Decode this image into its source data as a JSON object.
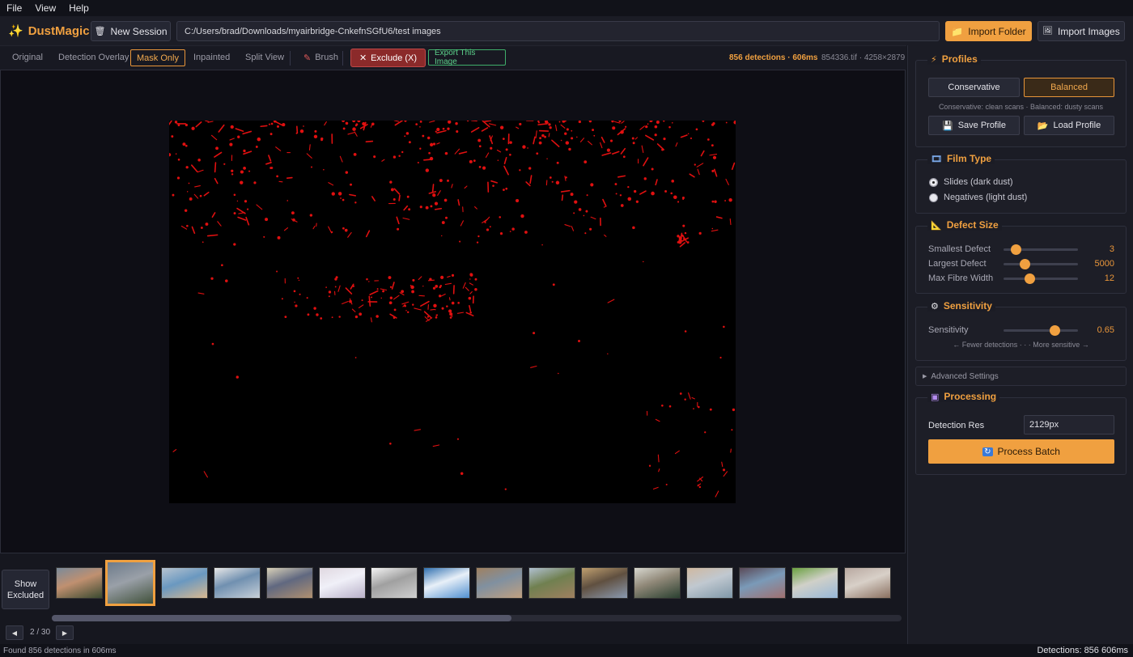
{
  "menu": {
    "file": "File",
    "view": "View",
    "help": "Help"
  },
  "app": {
    "name": "DustMagic"
  },
  "toolbar": {
    "new_session": "New Session",
    "path": "C:/Users/brad/Downloads/myairbridge-CnkefnSGfU6/test images",
    "import_folder": "Import Folder",
    "import_images": "Import Images"
  },
  "viewbar": {
    "tabs": [
      "Original",
      "Detection Overlay",
      "Mask Only",
      "Inpainted",
      "Split View"
    ],
    "brush": "Brush",
    "exclude": "Exclude (X)",
    "export": "Export This Image",
    "detections": "856 detections · 606ms",
    "file_info": "854336.tif · 4258×2879"
  },
  "profiles": {
    "title": "Profiles",
    "conservative": "Conservative",
    "balanced": "Balanced",
    "hint": "Conservative: clean scans · Balanced: dusty scans",
    "save": "Save Profile",
    "load": "Load Profile"
  },
  "film_type": {
    "title": "Film Type",
    "options": [
      "Slides (dark dust)",
      "Negatives (light dust)"
    ],
    "selected_index": 0
  },
  "defect_size": {
    "title": "Defect Size",
    "sliders": [
      {
        "label": "Smallest Defect",
        "value": "3",
        "level": 0.16
      },
      {
        "label": "Largest Defect",
        "value": "5000",
        "level": 0.28
      },
      {
        "label": "Max Fibre Width",
        "value": "12",
        "level": 0.35
      }
    ]
  },
  "sensitivity": {
    "title": "Sensitivity",
    "label": "Sensitivity",
    "value": "0.65",
    "level": 0.68,
    "hint": "← Fewer detections · · · More sensitive →"
  },
  "advanced": {
    "label": "Advanced Settings"
  },
  "processing": {
    "title": "Processing",
    "detection_res_label": "Detection Res",
    "detection_res_value": "2129px",
    "process_batch": "Process Batch"
  },
  "filmstrip": {
    "show_excluded": "Show Excluded",
    "page": "2 / 30",
    "selected_index": 1
  },
  "status": {
    "message": "Found 856 detections in 606ms",
    "right": "Detections: 856  606ms"
  },
  "colors": {
    "accent": "#f0a040",
    "danger": "#8b2a2a",
    "success": "#3fae6a",
    "mask_dust": "#e01010"
  }
}
